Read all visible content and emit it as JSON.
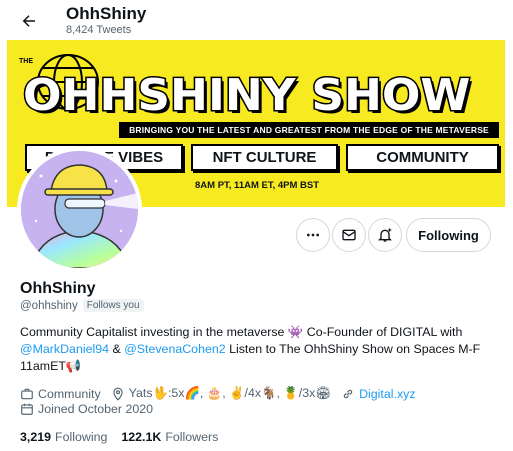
{
  "header": {
    "title": "OhhShiny",
    "subtitle": "8,424 Tweets",
    "back_icon": "arrow-left-icon"
  },
  "banner": {
    "kicker": "THE",
    "title": "OHHSHINY SHOW",
    "tagline": "BRINGING YOU THE LATEST AND GREATEST FROM THE EDGE OF THE METAVERSE",
    "pills": [
      "POSITIVE VIBES",
      "NFT CULTURE",
      "COMMUNITY"
    ],
    "times": "8AM PT, 11AM ET, 4PM BST",
    "background_color": "#f7ea20"
  },
  "actions": {
    "more_icon": "ellipsis-icon",
    "message_icon": "envelope-icon",
    "notify_icon": "bell-plus-icon",
    "follow_label": "Following"
  },
  "profile": {
    "name": "OhhShiny",
    "handle": "@ohhshiny",
    "follows_you": "Follows you",
    "bio": {
      "line1": "Community Capitalist investing in the metaverse 👾 Co-Founder of DIGITAL with",
      "mention1": "@MarkDaniel94",
      "amp": " & ",
      "mention2": "@StevenaCohen2",
      "line2_rest": " Listen to The OhhShiny Show on Spaces M-F",
      "line3": "11amET📢"
    },
    "meta": {
      "category": "Community",
      "location": "Yats🖖:5x🌈, 🎂, ✌️/4x🐐, 🍍/3x🏟",
      "website": "Digital.xyz",
      "joined": "Joined October 2020"
    },
    "stats": {
      "following_count": "3,219",
      "following_label": "Following",
      "followers_count": "122.1K",
      "followers_label": "Followers"
    }
  },
  "colors": {
    "accent": "#1d9bf0",
    "secondary_text": "#536471",
    "border": "#cfd9de"
  }
}
